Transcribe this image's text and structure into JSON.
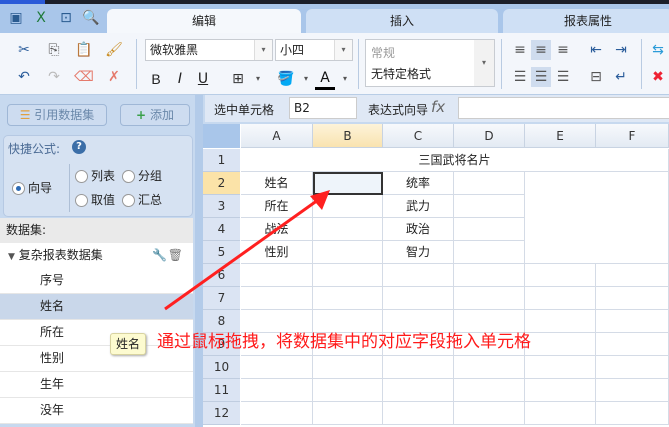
{
  "quick_icons": [
    "save-icon",
    "excel-icon",
    "preview-icon",
    "print-preview-icon"
  ],
  "tabs": [
    {
      "label": "编辑",
      "active": true
    },
    {
      "label": "插入"
    },
    {
      "label": "报表属性"
    }
  ],
  "toolbar": {
    "font": "微软雅黑",
    "size": "小四",
    "format_category": "常规",
    "format_value": "无特定格式",
    "bold": "B",
    "italic": "I",
    "underline": "U",
    "font_color": "A"
  },
  "left": {
    "ref_dataset": "引用数据集",
    "add": "添加",
    "quick_formula": "快捷公式:",
    "help": "?",
    "radios": [
      "向导",
      "列表",
      "分组",
      "取值",
      "汇总"
    ],
    "dataset_label": "数据集:",
    "dataset_name": "复杂报表数据集",
    "fields": [
      "序号",
      "姓名",
      "所在",
      "性别",
      "生年",
      "没年"
    ],
    "tooltip": "姓名"
  },
  "formula_bar": {
    "selected_label": "选中单元格",
    "selected_value": "B2",
    "expr_label": "表达式向导",
    "fx": "fx",
    "expr_value": ""
  },
  "grid": {
    "columns": [
      "A",
      "B",
      "C",
      "D",
      "E",
      "F"
    ],
    "rows": [
      "1",
      "2",
      "3",
      "4",
      "5",
      "6",
      "7",
      "8",
      "9",
      "10",
      "11",
      "12"
    ],
    "title": "三国武将名片",
    "a": [
      "姓名",
      "所在",
      "战法",
      "性别"
    ],
    "c": [
      "统率",
      "武力",
      "政治",
      "智力"
    ]
  },
  "annotation": "通过鼠标拖拽，将数据集中的对应字段拖入单元格",
  "colors": {
    "accent": "#2d6bb5",
    "annotation": "#ff1a1a"
  }
}
